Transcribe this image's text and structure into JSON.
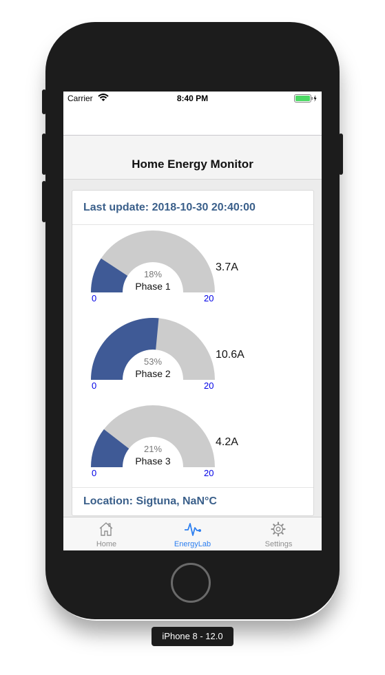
{
  "status_bar": {
    "carrier": "Carrier",
    "time": "8:40 PM"
  },
  "header": {
    "title": "Home Energy Monitor"
  },
  "card": {
    "last_update": "Last update: 2018-10-30 20:40:00",
    "location": "Location: Sigtuna, NaN°C"
  },
  "gauges": [
    {
      "name": "Phase 1",
      "percent_label": "18%",
      "fraction": 0.185,
      "min": "0",
      "max": "20",
      "value": "3.7A"
    },
    {
      "name": "Phase 2",
      "percent_label": "53%",
      "fraction": 0.53,
      "min": "0",
      "max": "20",
      "value": "10.6A"
    },
    {
      "name": "Phase 3",
      "percent_label": "21%",
      "fraction": 0.21,
      "min": "0",
      "max": "20",
      "value": "4.2A"
    }
  ],
  "tabs": [
    {
      "label": "Home",
      "icon": "home-icon"
    },
    {
      "label": "EnergyLab",
      "icon": "pulse-icon"
    },
    {
      "label": "Settings",
      "icon": "gear-icon"
    }
  ],
  "device_label": "iPhone 8 - 12.0",
  "colors": {
    "gauge_fill": "#3f5a96",
    "gauge_track": "#cccccc",
    "label_blue": "#3a5f8a",
    "tab_active": "#2d7ff0"
  }
}
